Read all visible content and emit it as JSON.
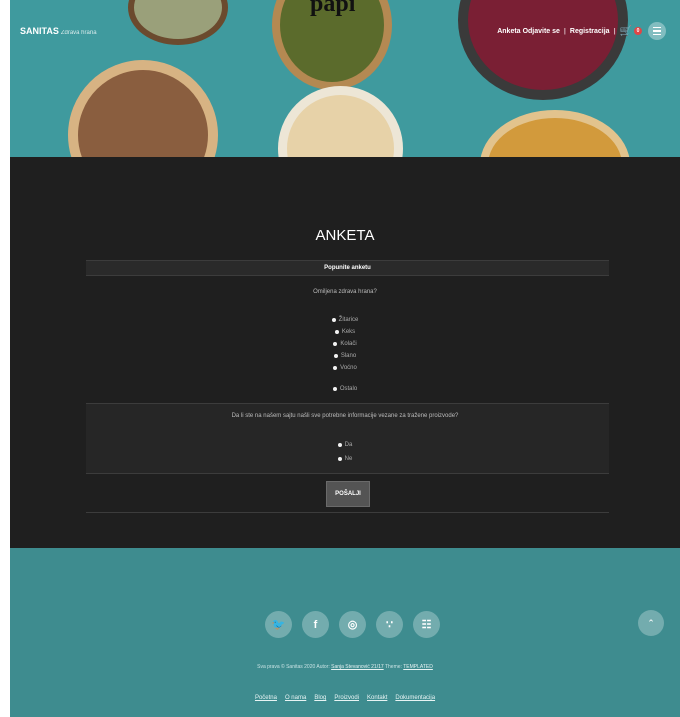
{
  "hero": {
    "title": "papi",
    "brand": "SANITAS",
    "tagline": "Zdrava hrana",
    "nav": [
      "Anketa",
      "Odjavite se",
      "Registracija"
    ],
    "cart_icon": "cart-icon",
    "cart_count": "0",
    "menu_icon": "hamburger-icon"
  },
  "survey": {
    "heading": "ANKETA",
    "bar_title": "Popunite anketu",
    "q1": "Omiljena zdrava hrana?",
    "q1_options": [
      "Žitarice",
      "Keks",
      "Kolači",
      "Slano",
      "Voćno",
      "Ostalo"
    ],
    "q2": "Da li ste na našem sajtu našli sve potrebne informacije vezane za tražene proizvode?",
    "q2_options": [
      "Da",
      "Ne"
    ],
    "submit": "POŠALJI"
  },
  "footer": {
    "socials": [
      "twitter-icon",
      "facebook-icon",
      "instagram-icon",
      "rss-icon",
      "sitemap-icon"
    ],
    "credit_prefix": "Sva prava © Sanitas 2020 Autor: ",
    "author": "Sanja Stevanović 21/17",
    "credit_mid": "  Theme: ",
    "theme": "TEMPLATED",
    "links": [
      "Početna",
      "O nama",
      "Blog",
      "Proizvodi",
      "Kontakt",
      "Dokumentacija"
    ],
    "to_top_icon": "chevron-up-icon"
  },
  "colors": {
    "hero_bg": "#3f9a9e",
    "main_bg": "#1f1f1f",
    "footer_bg": "#3e8c8f"
  }
}
